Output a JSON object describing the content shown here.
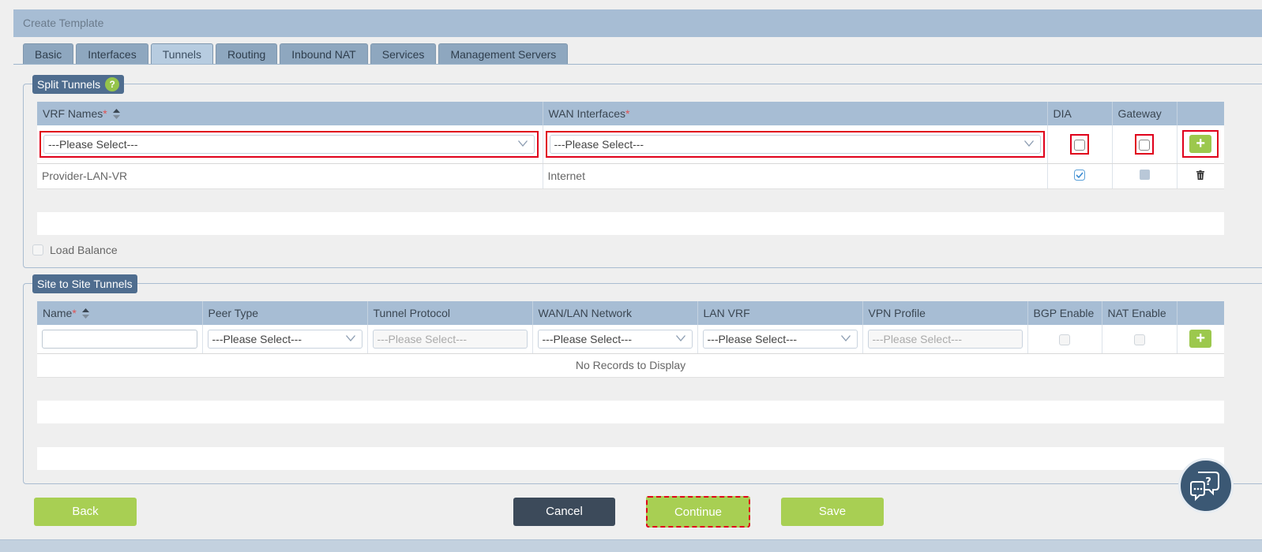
{
  "title": "Create Template",
  "tabs": [
    {
      "label": "Basic",
      "active": false
    },
    {
      "label": "Interfaces",
      "active": false
    },
    {
      "label": "Tunnels",
      "active": true
    },
    {
      "label": "Routing",
      "active": false
    },
    {
      "label": "Inbound NAT",
      "active": false
    },
    {
      "label": "Services",
      "active": false
    },
    {
      "label": "Management Servers",
      "active": false
    }
  ],
  "split": {
    "legend": "Split Tunnels",
    "help": "?",
    "columns": {
      "vrf": "VRF Names",
      "wan": "WAN Interfaces",
      "dia": "DIA",
      "gateway": "Gateway"
    },
    "required_mark": "*",
    "vrf_placeholder": "---Please Select---",
    "wan_placeholder": "---Please Select---",
    "add": "+",
    "row": {
      "vrf": "Provider-LAN-VR",
      "wan": "Internet",
      "dia_checked": true,
      "gateway_checked": false
    },
    "load_balance": "Load Balance"
  },
  "site": {
    "legend": "Site to Site Tunnels",
    "columns": {
      "name": "Name",
      "peer": "Peer Type",
      "protocol": "Tunnel Protocol",
      "network": "WAN/LAN Network",
      "lanvrf": "LAN VRF",
      "vpn": "VPN Profile",
      "bgp": "BGP Enable",
      "nat": "NAT Enable"
    },
    "required_mark": "*",
    "peer_placeholder": "---Please Select---",
    "protocol_placeholder": "---Please Select---",
    "network_placeholder": "---Please Select---",
    "lanvrf_placeholder": "---Please Select---",
    "vpn_placeholder": "---Please Select---",
    "add": "+",
    "empty": "No Records to Display"
  },
  "buttons": {
    "back": "Back",
    "cancel": "Cancel",
    "continue": "Continue",
    "save": "Save"
  },
  "colors": {
    "accent_green": "#a8cf53",
    "header_blue": "#a7bdd4",
    "dark": "#3c4a5a",
    "highlight_red": "#e0001b"
  }
}
